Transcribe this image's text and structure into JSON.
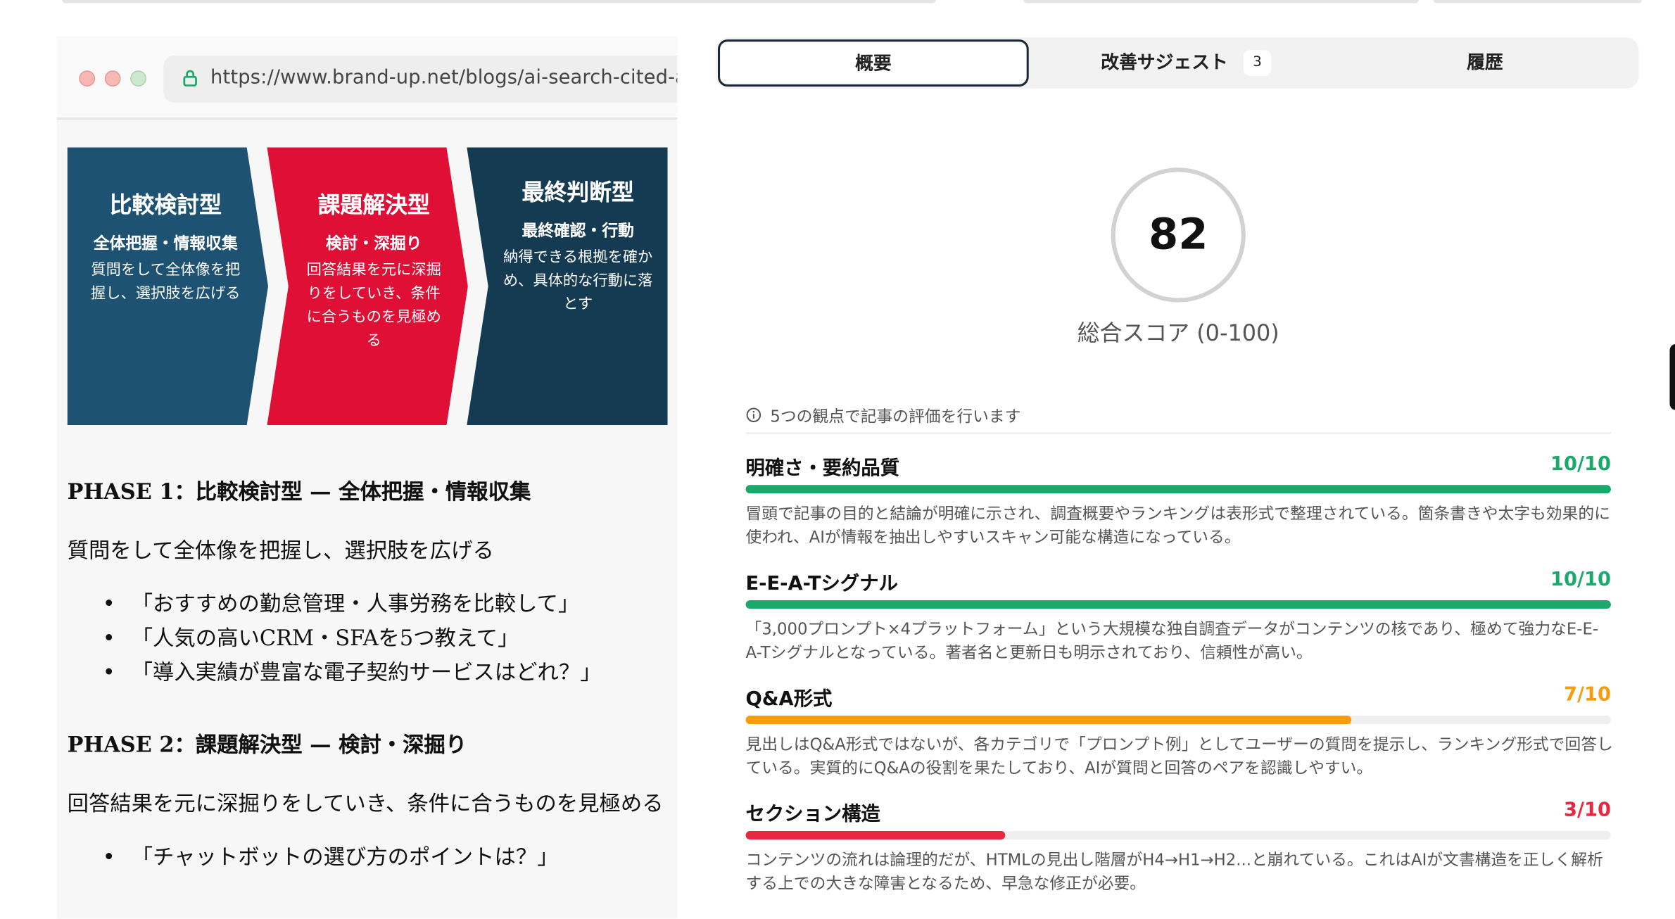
{
  "browser": {
    "url": "https://www.brand-up.net/blogs/ai-search-cited-av"
  },
  "article": {
    "steps": [
      {
        "title": "比較検討型",
        "subtitle": "全体把握・情報収集",
        "desc": "質問をして全体像を把握し、選択肢を広げる",
        "color": "#1d5273"
      },
      {
        "title": "課題解決型",
        "subtitle": "検討・深掘り",
        "desc": "回答結果を元に深掘りをしていき、条件に合うものを見極める",
        "color": "#e00f35"
      },
      {
        "title": "最終判断型",
        "subtitle": "最終確認・行動",
        "desc": "納得できる根拠を確かめ、具体的な行動に落とす",
        "color": "#153b52"
      }
    ],
    "phase1_heading": "PHASE 1：比較検討型 — 全体把握・情報収集",
    "phase1_text": "質問をして全体像を把握し、選択肢を広げる",
    "phase1_bullets": [
      "「おすすめの勤怠管理・人事労務を比較して」",
      "「人気の高いCRM・SFAを5つ教えて」",
      "「導入実績が豊富な電子契約サービスはどれ？」"
    ],
    "phase2_heading": "PHASE 2：課題解決型 — 検討・深掘り",
    "phase2_text": "回答結果を元に深掘りをしていき、条件に合うものを見極める",
    "phase2_bullets": [
      "「チャットボットの選び方のポイントは？」"
    ]
  },
  "tabs": [
    {
      "label": "概要",
      "active": true
    },
    {
      "label": "改善サジェスト",
      "badge": "3"
    },
    {
      "label": "履歴"
    }
  ],
  "score": {
    "value": "82",
    "label": "総合スコア (0-100)"
  },
  "info": "5つの観点で記事の評価を行います",
  "criteria": [
    {
      "name": "明確さ・要約品質",
      "score": "10/10",
      "fraction": 1.0,
      "color": "#1aa86b",
      "desc": "冒頭で記事の目的と結論が明確に示され、調査概要やランキングは表形式で整理されている。箇条書きや太字も効果的に使われ、AIが情報を抽出しやすいスキャン可能な構造になっている。"
    },
    {
      "name": "E-E-A-Tシグナル",
      "score": "10/10",
      "fraction": 1.0,
      "color": "#1aa86b",
      "desc": "「3,000プロンプト×4プラットフォーム」という大規模な独自調査データがコンテンツの核であり、極めて強力なE-E-A-Tシグナルとなっている。著者名と更新日も明示されており、信頼性が高い。"
    },
    {
      "name": "Q&A形式",
      "score": "7/10",
      "fraction": 0.7,
      "color": "#f59c0f",
      "desc": "見出しはQ&A形式ではないが、各カテゴリで「プロンプト例」としてユーザーの質問を提示し、ランキング形式で回答している。実質的にQ&Aの役割を果たしており、AIが質問と回答のペアを認識しやすい。"
    },
    {
      "name": "セクション構造",
      "score": "3/10",
      "fraction": 0.3,
      "color": "#e8283e",
      "desc": "コンテンツの流れは論理的だが、HTMLの見出し階層がH4→H1→H2...と崩れている。これはAIが文書構造を正しく解析する上での大きな障害となるため、早急な修正が必要。"
    }
  ]
}
